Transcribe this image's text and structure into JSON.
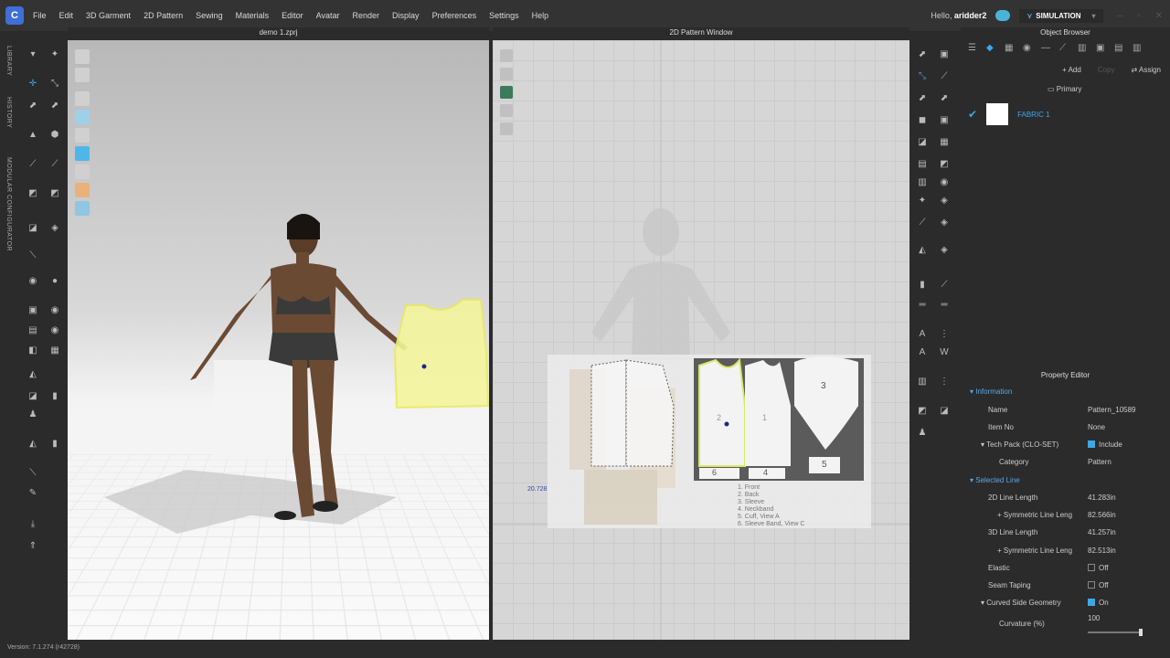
{
  "app": {
    "logo_glyph": "C",
    "menu": [
      "File",
      "Edit",
      "3D Garment",
      "2D Pattern",
      "Sewing",
      "Materials",
      "Editor",
      "Avatar",
      "Render",
      "Display",
      "Preferences",
      "Settings",
      "Help"
    ],
    "greeting": "Hello,",
    "username": "aridder2",
    "mode": "SIMULATION"
  },
  "side_tabs": [
    "LIBRARY",
    "HISTORY",
    "MODULAR CONFIGURATOR"
  ],
  "viewport3d": {
    "title": "demo 1.zprj"
  },
  "viewport2d": {
    "title": "2D Pattern Window",
    "measure": "20.728",
    "pieces": [
      "1",
      "2",
      "3",
      "4",
      "5",
      "6"
    ],
    "legend": [
      "1. Front",
      "2. Back",
      "3. Sleeve",
      "4. Neckband",
      "5. Cuff, View A",
      "6. Sleeve Band, View C"
    ]
  },
  "object_browser": {
    "title": "Object Browser",
    "add": "Add",
    "copy": "Copy",
    "assign": "Assign",
    "group": "Primary",
    "fabric": "FABRIC 1"
  },
  "property_editor": {
    "title": "Property Editor",
    "information": "Information",
    "name_label": "Name",
    "name_value": "Pattern_10589",
    "item_no_label": "Item No",
    "item_no_value": "None",
    "techpack_label": "Tech Pack (CLO-SET)",
    "techpack_value": "Include",
    "category_label": "Category",
    "category_value": "Pattern",
    "selected_line": "Selected Line",
    "line2d_label": "2D Line Length",
    "line2d_value": "41.283in",
    "sym2d_label": "Symmetric Line Leng",
    "sym2d_value": "82.566in",
    "line3d_label": "3D Line Length",
    "line3d_value": "41.257in",
    "sym3d_label": "Symmetric Line Leng",
    "sym3d_value": "82.513in",
    "elastic_label": "Elastic",
    "elastic_value": "Off",
    "seam_label": "Seam Taping",
    "seam_value": "Off",
    "curved_label": "Curved Side Geometry",
    "curved_value": "On",
    "curvature_label": "Curvature (%)",
    "curvature_value": "100"
  },
  "status": {
    "version": "Version: 7.1.274 (r42728)"
  },
  "colors": {
    "accent": "#3fa7e6",
    "highlight": "#f3f59c"
  }
}
